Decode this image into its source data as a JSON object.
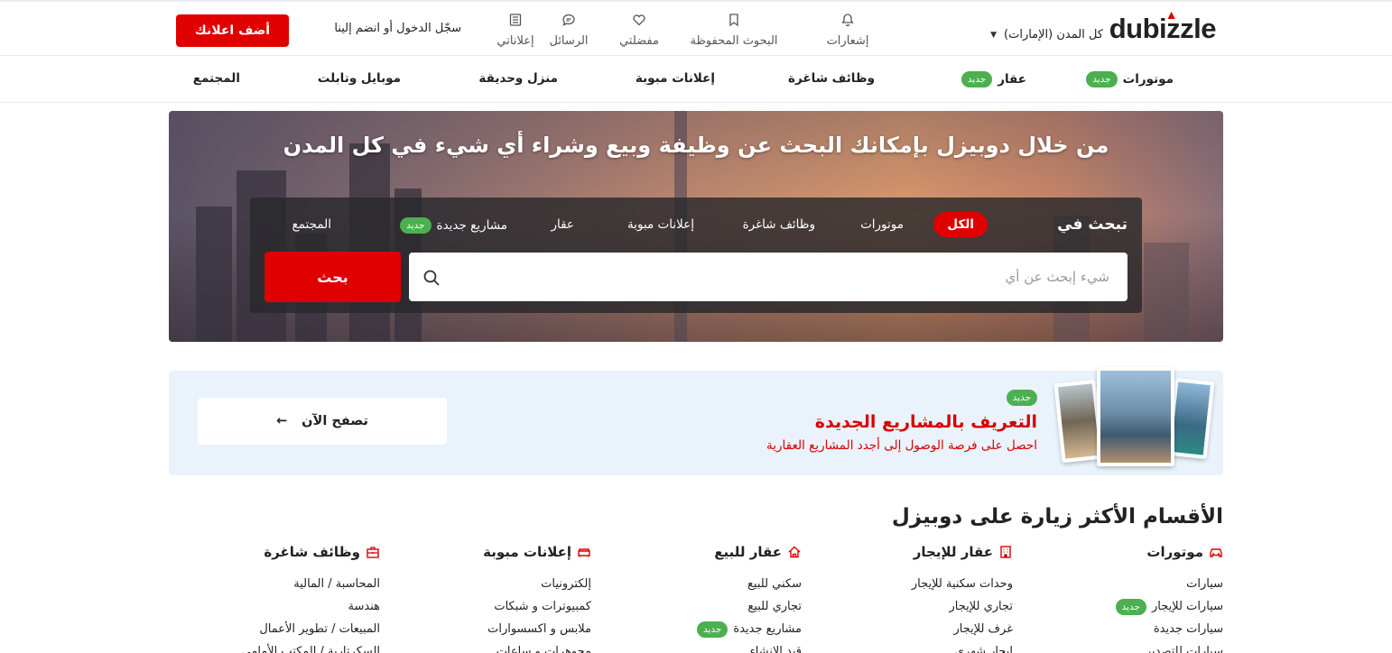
{
  "header": {
    "logo": "dubizzle",
    "city": "كل المدن (الإمارات)",
    "icons": [
      {
        "icon": "bell-icon",
        "label": "إشعارات"
      },
      {
        "icon": "saved-search-icon",
        "label": "البحوث المحفوظة"
      },
      {
        "icon": "heart-icon",
        "label": "مفضلتي"
      },
      {
        "icon": "chat-icon",
        "label": "الرسائل"
      },
      {
        "icon": "list-icon",
        "label": "إعلاناتي"
      }
    ],
    "login": "سجّل الدخول أو انضم إلينا",
    "post_ad": "أضف اعلانك"
  },
  "categories_nav": [
    {
      "label": "موتورات",
      "badge": "جديد"
    },
    {
      "label": "عقار",
      "badge": "جديد"
    },
    {
      "label": "وظائف شاغرة"
    },
    {
      "label": "إعلانات مبوبة"
    },
    {
      "label": "منزل وحديقة"
    },
    {
      "label": "موبايل وتابلت"
    },
    {
      "label": "المجتمع"
    }
  ],
  "hero": {
    "title": "من خلال دوبيزل بإمكانك البحث عن وظيفة وبيع وشراء أي شيء في كل المدن",
    "search_in": "تبحث في",
    "tabs": [
      {
        "label": "الكل",
        "active": true
      },
      {
        "label": "موتورات"
      },
      {
        "label": "وظائف شاغرة"
      },
      {
        "label": "إعلانات مبوبة"
      },
      {
        "label": "عقار"
      },
      {
        "label": "مشاريع جديدة",
        "badge": "جديد"
      },
      {
        "label": "المجتمع"
      }
    ],
    "search_placeholder": "شيء إبحث عن أي",
    "search_button": "بحث"
  },
  "promo": {
    "badge": "جديد",
    "title": "التعريف بالمشاريع الجديدة",
    "subtitle": "احصل على فرصة الوصول إلى أجدد المشاريع العقارية",
    "button": "تصفح الآن"
  },
  "popular": {
    "title": "الأقسام الأكثر زيارة على دوبيزل",
    "columns": [
      {
        "icon": "car-icon",
        "title": "موتورات",
        "items": [
          {
            "label": "سيارات"
          },
          {
            "label": "سيارات للإيجار",
            "badge": "جديد"
          },
          {
            "label": "سيارات جديدة"
          },
          {
            "label": "سيارات للتصدير"
          }
        ]
      },
      {
        "icon": "building-icon",
        "title": "عقار للإيجار",
        "items": [
          {
            "label": "وحدات سكنية للإيجار"
          },
          {
            "label": "تجاري للإيجار"
          },
          {
            "label": "غرف للإيجار"
          },
          {
            "label": "ايجار شهري"
          }
        ]
      },
      {
        "icon": "house-icon",
        "title": "عقار للبيع",
        "items": [
          {
            "label": "سكني للبيع"
          },
          {
            "label": "تجاري للبيع"
          },
          {
            "label": "مشاريع جديدة",
            "badge": "جديد"
          },
          {
            "label": "قيد الإنشاء"
          }
        ]
      },
      {
        "icon": "sofa-icon",
        "title": "إعلانات مبوبة",
        "items": [
          {
            "label": "إلكترونيات"
          },
          {
            "label": "كمبيوترات و شبكات"
          },
          {
            "label": "ملابس و اكسسوارات"
          },
          {
            "label": "مجوهرات و ساعات"
          }
        ]
      },
      {
        "icon": "briefcase-icon",
        "title": "وظائف شاغرة",
        "items": [
          {
            "label": "المحاسبة / المالية"
          },
          {
            "label": "هندسة"
          },
          {
            "label": "المبيعات / تطوير الأعمال"
          },
          {
            "label": "السكرتارية / المكتب الأمامي"
          }
        ]
      }
    ]
  },
  "colors": {
    "brand_red": "#e00000",
    "new_badge": "#4caf50",
    "promo_bg": "#eaf3fb"
  }
}
